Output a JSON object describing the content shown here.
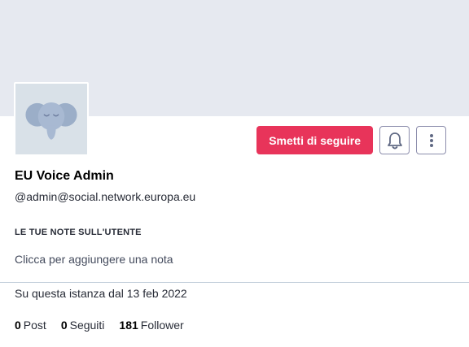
{
  "profile": {
    "display_name": "EU Voice Admin",
    "account": "@admin@social.network.europa.eu",
    "avatar_icon": "mastodon-elephant-icon"
  },
  "actions": {
    "unfollow_label": "Smetti di seguire",
    "notify_icon": "bell-icon",
    "menu_icon": "kebab-menu-icon"
  },
  "note": {
    "label": "LE TUE NOTE SULL'UTENTE",
    "placeholder": "Clicca per aggiungere una nota"
  },
  "joined": "Su questa istanza dal 13 feb 2022",
  "stats": [
    {
      "count": "0",
      "label": "Post"
    },
    {
      "count": "0",
      "label": "Seguiti"
    },
    {
      "count": "181",
      "label": "Follower"
    }
  ],
  "colors": {
    "accent": "#e8345a",
    "banner": "#e6e9f0",
    "avatar_bg": "#d9e1e8"
  }
}
